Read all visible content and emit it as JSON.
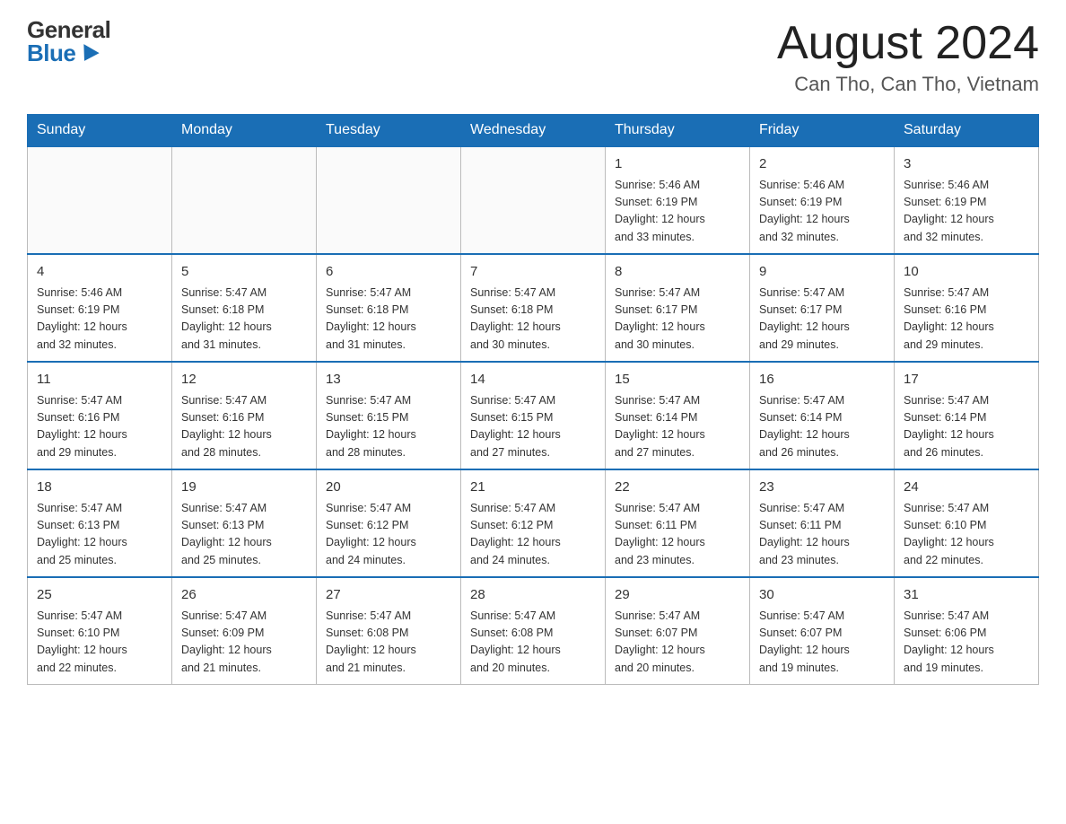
{
  "logo": {
    "general": "General",
    "blue": "Blue"
  },
  "header": {
    "title": "August 2024",
    "location": "Can Tho, Can Tho, Vietnam"
  },
  "days_of_week": [
    "Sunday",
    "Monday",
    "Tuesday",
    "Wednesday",
    "Thursday",
    "Friday",
    "Saturday"
  ],
  "weeks": [
    {
      "days": [
        {
          "number": "",
          "info": "",
          "empty": true
        },
        {
          "number": "",
          "info": "",
          "empty": true
        },
        {
          "number": "",
          "info": "",
          "empty": true
        },
        {
          "number": "",
          "info": "",
          "empty": true
        },
        {
          "number": "1",
          "info": "Sunrise: 5:46 AM\nSunset: 6:19 PM\nDaylight: 12 hours\nand 33 minutes.",
          "empty": false
        },
        {
          "number": "2",
          "info": "Sunrise: 5:46 AM\nSunset: 6:19 PM\nDaylight: 12 hours\nand 32 minutes.",
          "empty": false
        },
        {
          "number": "3",
          "info": "Sunrise: 5:46 AM\nSunset: 6:19 PM\nDaylight: 12 hours\nand 32 minutes.",
          "empty": false
        }
      ]
    },
    {
      "days": [
        {
          "number": "4",
          "info": "Sunrise: 5:46 AM\nSunset: 6:19 PM\nDaylight: 12 hours\nand 32 minutes.",
          "empty": false
        },
        {
          "number": "5",
          "info": "Sunrise: 5:47 AM\nSunset: 6:18 PM\nDaylight: 12 hours\nand 31 minutes.",
          "empty": false
        },
        {
          "number": "6",
          "info": "Sunrise: 5:47 AM\nSunset: 6:18 PM\nDaylight: 12 hours\nand 31 minutes.",
          "empty": false
        },
        {
          "number": "7",
          "info": "Sunrise: 5:47 AM\nSunset: 6:18 PM\nDaylight: 12 hours\nand 30 minutes.",
          "empty": false
        },
        {
          "number": "8",
          "info": "Sunrise: 5:47 AM\nSunset: 6:17 PM\nDaylight: 12 hours\nand 30 minutes.",
          "empty": false
        },
        {
          "number": "9",
          "info": "Sunrise: 5:47 AM\nSunset: 6:17 PM\nDaylight: 12 hours\nand 29 minutes.",
          "empty": false
        },
        {
          "number": "10",
          "info": "Sunrise: 5:47 AM\nSunset: 6:16 PM\nDaylight: 12 hours\nand 29 minutes.",
          "empty": false
        }
      ]
    },
    {
      "days": [
        {
          "number": "11",
          "info": "Sunrise: 5:47 AM\nSunset: 6:16 PM\nDaylight: 12 hours\nand 29 minutes.",
          "empty": false
        },
        {
          "number": "12",
          "info": "Sunrise: 5:47 AM\nSunset: 6:16 PM\nDaylight: 12 hours\nand 28 minutes.",
          "empty": false
        },
        {
          "number": "13",
          "info": "Sunrise: 5:47 AM\nSunset: 6:15 PM\nDaylight: 12 hours\nand 28 minutes.",
          "empty": false
        },
        {
          "number": "14",
          "info": "Sunrise: 5:47 AM\nSunset: 6:15 PM\nDaylight: 12 hours\nand 27 minutes.",
          "empty": false
        },
        {
          "number": "15",
          "info": "Sunrise: 5:47 AM\nSunset: 6:14 PM\nDaylight: 12 hours\nand 27 minutes.",
          "empty": false
        },
        {
          "number": "16",
          "info": "Sunrise: 5:47 AM\nSunset: 6:14 PM\nDaylight: 12 hours\nand 26 minutes.",
          "empty": false
        },
        {
          "number": "17",
          "info": "Sunrise: 5:47 AM\nSunset: 6:14 PM\nDaylight: 12 hours\nand 26 minutes.",
          "empty": false
        }
      ]
    },
    {
      "days": [
        {
          "number": "18",
          "info": "Sunrise: 5:47 AM\nSunset: 6:13 PM\nDaylight: 12 hours\nand 25 minutes.",
          "empty": false
        },
        {
          "number": "19",
          "info": "Sunrise: 5:47 AM\nSunset: 6:13 PM\nDaylight: 12 hours\nand 25 minutes.",
          "empty": false
        },
        {
          "number": "20",
          "info": "Sunrise: 5:47 AM\nSunset: 6:12 PM\nDaylight: 12 hours\nand 24 minutes.",
          "empty": false
        },
        {
          "number": "21",
          "info": "Sunrise: 5:47 AM\nSunset: 6:12 PM\nDaylight: 12 hours\nand 24 minutes.",
          "empty": false
        },
        {
          "number": "22",
          "info": "Sunrise: 5:47 AM\nSunset: 6:11 PM\nDaylight: 12 hours\nand 23 minutes.",
          "empty": false
        },
        {
          "number": "23",
          "info": "Sunrise: 5:47 AM\nSunset: 6:11 PM\nDaylight: 12 hours\nand 23 minutes.",
          "empty": false
        },
        {
          "number": "24",
          "info": "Sunrise: 5:47 AM\nSunset: 6:10 PM\nDaylight: 12 hours\nand 22 minutes.",
          "empty": false
        }
      ]
    },
    {
      "days": [
        {
          "number": "25",
          "info": "Sunrise: 5:47 AM\nSunset: 6:10 PM\nDaylight: 12 hours\nand 22 minutes.",
          "empty": false
        },
        {
          "number": "26",
          "info": "Sunrise: 5:47 AM\nSunset: 6:09 PM\nDaylight: 12 hours\nand 21 minutes.",
          "empty": false
        },
        {
          "number": "27",
          "info": "Sunrise: 5:47 AM\nSunset: 6:08 PM\nDaylight: 12 hours\nand 21 minutes.",
          "empty": false
        },
        {
          "number": "28",
          "info": "Sunrise: 5:47 AM\nSunset: 6:08 PM\nDaylight: 12 hours\nand 20 minutes.",
          "empty": false
        },
        {
          "number": "29",
          "info": "Sunrise: 5:47 AM\nSunset: 6:07 PM\nDaylight: 12 hours\nand 20 minutes.",
          "empty": false
        },
        {
          "number": "30",
          "info": "Sunrise: 5:47 AM\nSunset: 6:07 PM\nDaylight: 12 hours\nand 19 minutes.",
          "empty": false
        },
        {
          "number": "31",
          "info": "Sunrise: 5:47 AM\nSunset: 6:06 PM\nDaylight: 12 hours\nand 19 minutes.",
          "empty": false
        }
      ]
    }
  ]
}
